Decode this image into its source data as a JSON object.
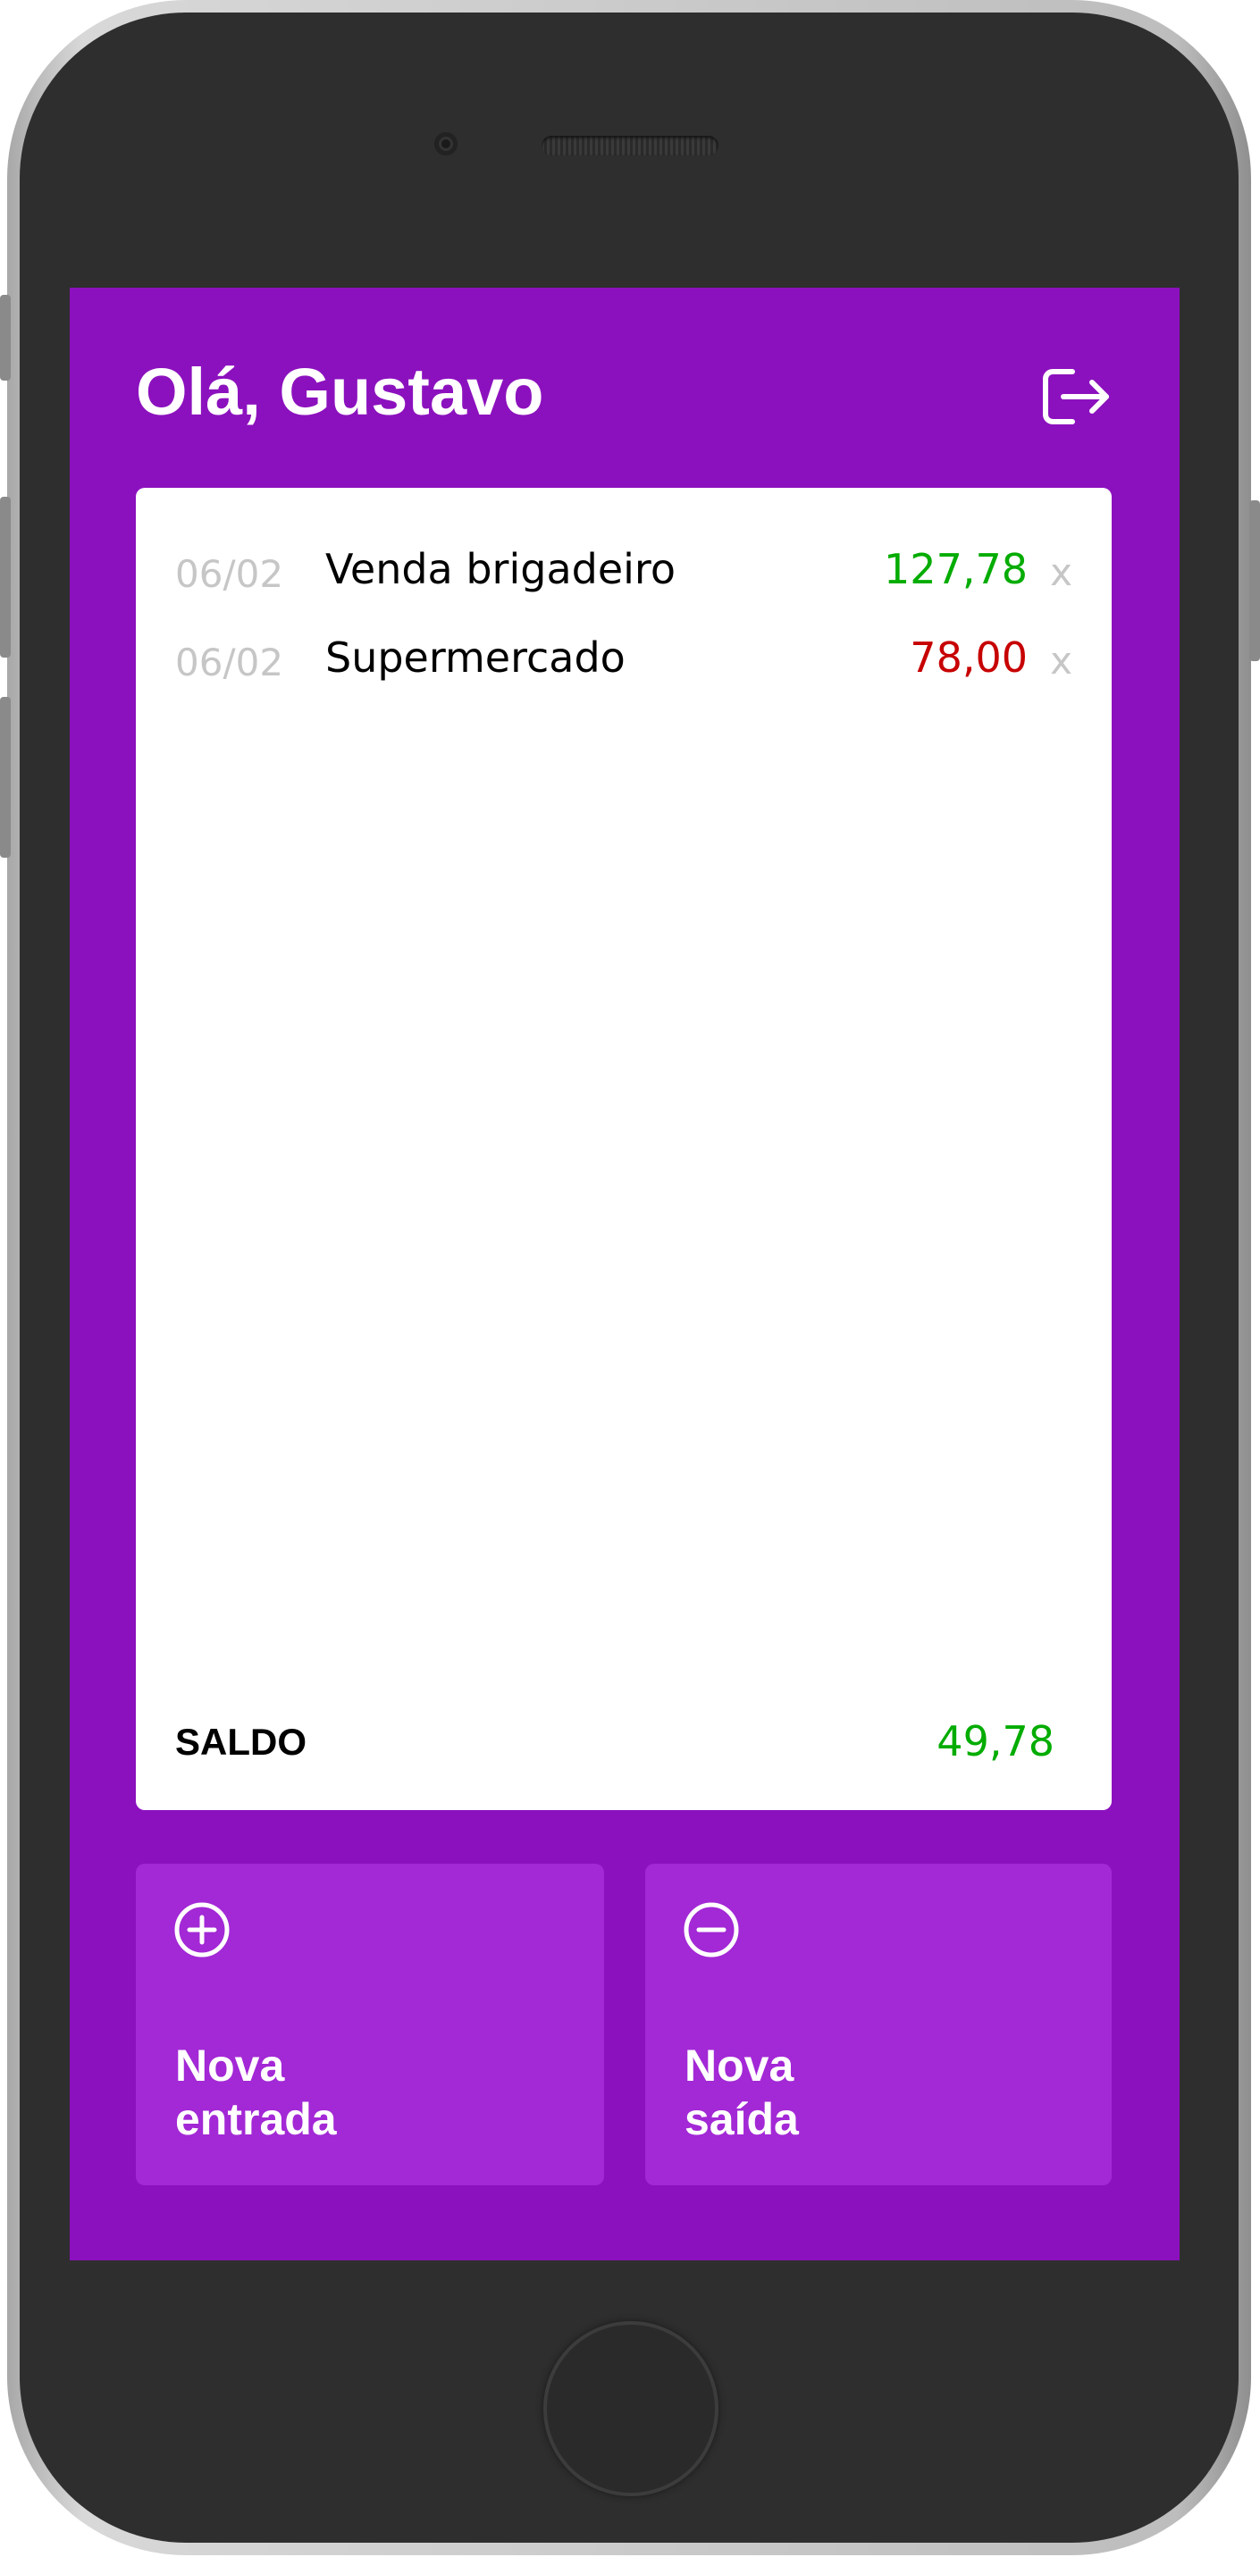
{
  "header": {
    "greeting": "Olá, Gustavo",
    "logout_icon": "logout-icon"
  },
  "transactions": [
    {
      "date": "06/02",
      "description": "Venda brigadeiro",
      "amount": "127,78",
      "type": "entrada",
      "delete_label": "x"
    },
    {
      "date": "06/02",
      "description": "Supermercado",
      "amount": "78,00",
      "type": "saida",
      "delete_label": "x"
    }
  ],
  "balance": {
    "label": "SALDO",
    "value": "49,78"
  },
  "actions": {
    "new_entry": {
      "label_line1": "Nova",
      "label_line2": "entrada",
      "icon": "plus-circle-icon"
    },
    "new_exit": {
      "label_line1": "Nova",
      "label_line2": "saída",
      "icon": "minus-circle-icon"
    }
  },
  "colors": {
    "background": "#8c11be",
    "card": "#ffffff",
    "button": "#a328d6",
    "income": "#03ac00",
    "expense": "#c70000",
    "muted": "#c6c6c6"
  }
}
